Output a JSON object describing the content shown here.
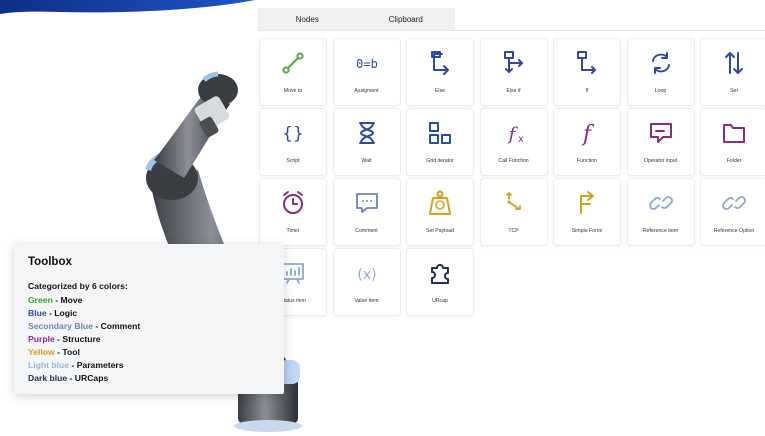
{
  "tabs": [
    {
      "label": "Nodes"
    },
    {
      "label": "Clipboard"
    }
  ],
  "tiles": [
    {
      "label": "Move to",
      "icon": "move-to-icon",
      "color": "#5aa64a"
    },
    {
      "label": "Assigment",
      "icon": "assignment-icon",
      "color": "#2f4a9a"
    },
    {
      "label": "Else",
      "icon": "else-icon",
      "color": "#2f4a9a"
    },
    {
      "label": "Else if",
      "icon": "else-if-icon",
      "color": "#2f4a9a"
    },
    {
      "label": "If",
      "icon": "if-icon",
      "color": "#2f4a9a"
    },
    {
      "label": "Loop",
      "icon": "loop-icon",
      "color": "#2f4a9a"
    },
    {
      "label": "Set",
      "icon": "set-icon",
      "color": "#2f4a9a"
    },
    {
      "label": "Script",
      "icon": "script-icon",
      "color": "#2f4a9a"
    },
    {
      "label": "Wait",
      "icon": "wait-icon",
      "color": "#2f4a9a"
    },
    {
      "label": "Grid iterator",
      "icon": "grid-iterator-icon",
      "color": "#2f4a9a"
    },
    {
      "label": "Call Function",
      "icon": "call-function-icon",
      "color": "#8b2a86"
    },
    {
      "label": "Function",
      "icon": "function-icon",
      "color": "#8b2a86"
    },
    {
      "label": "Operator input",
      "icon": "operator-input-icon",
      "color": "#8b2a86"
    },
    {
      "label": "Folder",
      "icon": "folder-icon",
      "color": "#8b2a86"
    },
    {
      "label": "Timer",
      "icon": "timer-icon",
      "color": "#8b2a86"
    },
    {
      "label": "Comment",
      "icon": "comment-icon",
      "color": "#6d83b8"
    },
    {
      "label": "Set Payload",
      "icon": "set-payload-icon",
      "color": "#d2a21c"
    },
    {
      "label": "TCP",
      "icon": "tcp-icon",
      "color": "#d2a21c"
    },
    {
      "label": "Simple Force",
      "icon": "simple-force-icon",
      "color": "#d2a21c"
    },
    {
      "label": "Reference item",
      "icon": "reference-item-icon",
      "color": "#8fa6cf"
    },
    {
      "label": "Reference Option",
      "icon": "reference-option-icon",
      "color": "#8fa6cf"
    },
    {
      "label": "Status item",
      "icon": "status-item-icon",
      "color": "#8fa6cf"
    },
    {
      "label": "Value item",
      "icon": "value-item-icon",
      "color": "#8fa6cf"
    },
    {
      "label": "URcap",
      "icon": "urcap-icon",
      "color": "#1d2f55"
    }
  ],
  "toolbox": {
    "title": "Toolbox",
    "subtitle": "Categorized by 6 colors:",
    "entries": [
      {
        "name": "Green",
        "desc": " - Move",
        "color": "#3a9a3a"
      },
      {
        "name": "Blue",
        "desc": " - Logic",
        "color": "#2f4a9a"
      },
      {
        "name": "Secondary Blue",
        "desc": " - Comment",
        "color": "#6d83b8"
      },
      {
        "name": "Purple",
        "desc": " - Structure",
        "color": "#8b2a86"
      },
      {
        "name": "Yellow",
        "desc": " - Tool",
        "color": "#d2a21c"
      },
      {
        "name": "Light blue",
        "desc": " - Parameters",
        "color": "#9fb3d6"
      },
      {
        "name": "Dark blue",
        "desc": " - URCaps",
        "color": "#1d2f55"
      }
    ]
  },
  "colors": {
    "brand": "#1a3d8f",
    "robot_accent": "#9cc3ee"
  }
}
